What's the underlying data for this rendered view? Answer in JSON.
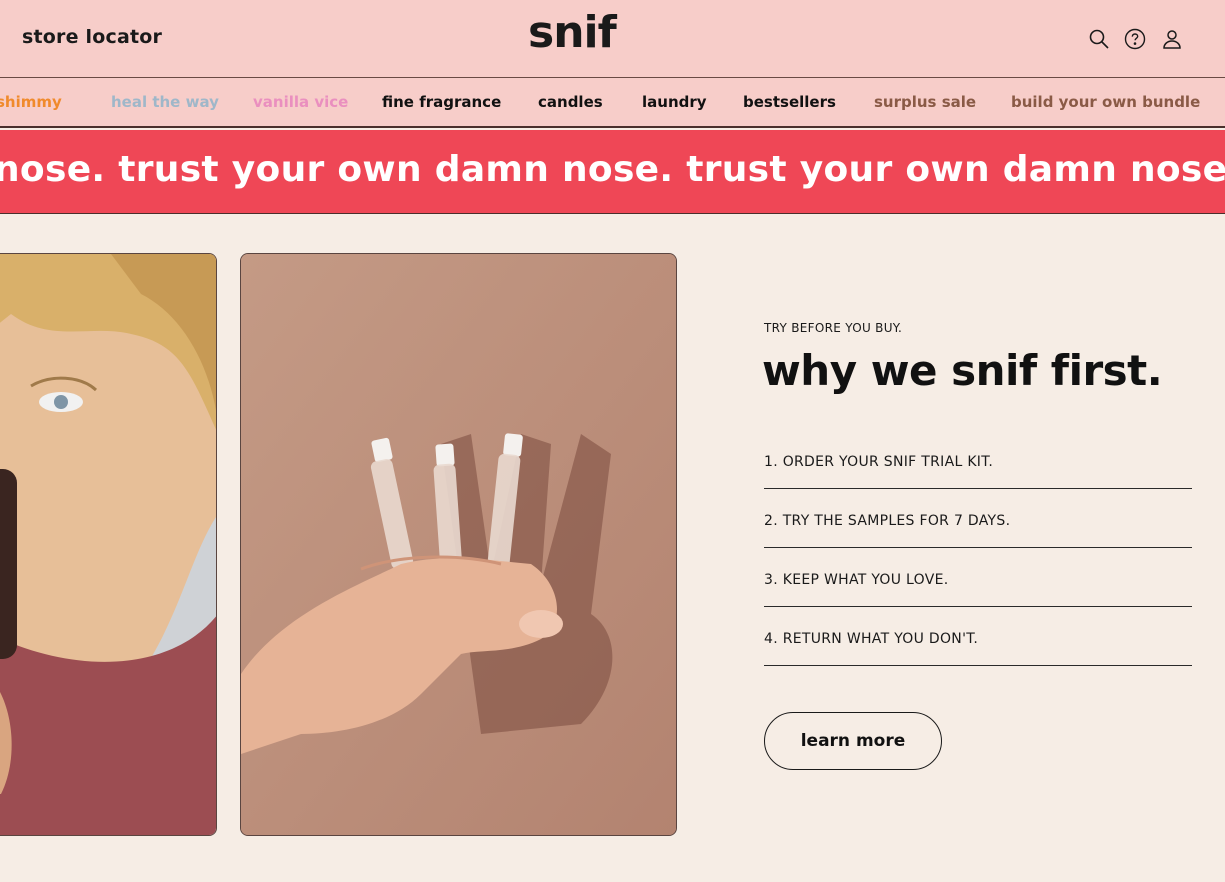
{
  "header": {
    "store_locator": "store locator",
    "logo": "snif",
    "icons": [
      "search-icon",
      "help-icon",
      "account-icon"
    ]
  },
  "nav": {
    "items": [
      {
        "label": "shimmy",
        "color": "#f08a2c"
      },
      {
        "label": "heal the way",
        "color": "#9fb7c9"
      },
      {
        "label": "vanilla vice",
        "color": "#ea8fbf"
      },
      {
        "label": "fine fragrance",
        "color": "#111111"
      },
      {
        "label": "candles",
        "color": "#111111"
      },
      {
        "label": "laundry",
        "color": "#111111"
      },
      {
        "label": "bestsellers",
        "color": "#111111"
      },
      {
        "label": "surplus sale",
        "color": "#8a5a46"
      },
      {
        "label": "build your own bundle",
        "color": "#8a5a46"
      }
    ]
  },
  "marquee": {
    "text": "nose. trust your own damn nose. trust your own damn nose. trust"
  },
  "section": {
    "eyebrow": "TRY BEFORE YOU BUY.",
    "headline": "why we snif first.",
    "steps": [
      "1. ORDER YOUR SNIF TRIAL KIT.",
      "2. TRY THE SAMPLES FOR 7 DAYS.",
      "3. KEEP WHAT YOU LOVE.",
      "4. RETURN WHAT YOU DON'T."
    ],
    "cta": "learn more"
  },
  "colors": {
    "header_bg": "#f7cdc9",
    "marquee_bg": "#ef4756",
    "page_bg": "#f6ede5"
  }
}
